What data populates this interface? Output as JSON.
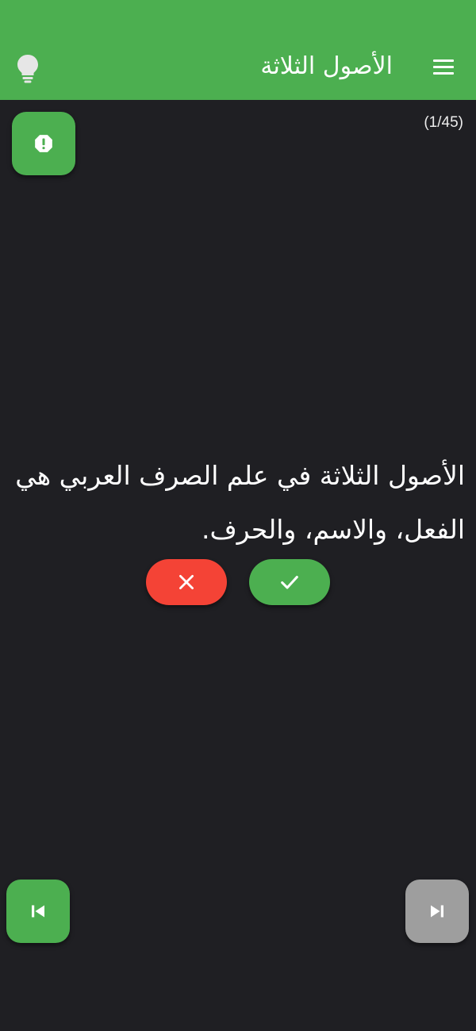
{
  "app_bar": {
    "title": "الأصول الثلاثة",
    "background": "#4caf50",
    "icons": {
      "menu": "menu-icon",
      "hint": "lightbulb-icon"
    }
  },
  "counter": "(1/45)",
  "question": {
    "text": "الأصول الثلاثة في علم الصرف العربي هي الفعل، والاسم، والحرف."
  },
  "answer_buttons": {
    "wrong": {
      "icon": "close-icon",
      "color": "#f44336"
    },
    "right": {
      "icon": "check-icon",
      "color": "#4caf50"
    }
  },
  "actions": {
    "report": {
      "icon": "alert-octagon-icon",
      "color": "#4caf50"
    },
    "previous": {
      "icon": "skip-previous-icon",
      "color": "#4caf50"
    },
    "next": {
      "icon": "skip-next-icon",
      "color": "#9e9e9e"
    }
  }
}
